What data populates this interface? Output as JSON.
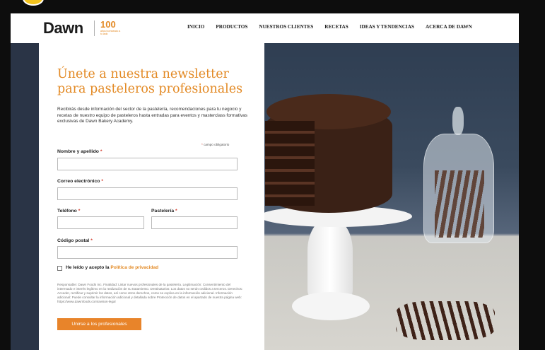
{
  "nav": {
    "logo_brand": "Dawn",
    "logo_anniversary": "100",
    "logo_anniversary_sub": "años horneando a tu lado",
    "items": [
      "INICIO",
      "PRODUCTOS",
      "NUESTROS CLIENTES",
      "RECETAS",
      "IDEAS Y TENDENCIAS",
      "ACERCA DE DAWN"
    ]
  },
  "form": {
    "title": "Únete a nuestra newsletter para pasteleros profesionales",
    "intro": "Recibirás desde información del sector de la pastelería, recomendaciones para tu negocio y recetas de nuestro equipo de pasteleros hasta entradas para eventos y masterclass formativas exclusivas de Dawn Bakery Academy.",
    "required_note": "campo obligatorio",
    "required_star": "*",
    "fields": {
      "name_label": "Nombre y apellido",
      "email_label": "Correo electrónico",
      "phone_label": "Teléfono",
      "bakery_label": "Pastelería",
      "postal_label": "Código postal"
    },
    "consent_prefix": "He leído y acepto la ",
    "consent_link": "Política de privacidad",
    "legal_text": "Responsable: Dawn Foods Inc. Finalidad: Listar nuevos profesionales de la pastelería. Legitimación: Consentimiento del interesado e interés legítimo en la realización de su tratamiento. Destinatarios: Los datos no serán cedidos a terceros. Derechos: Acceder, rectificar y suprimir los datos, así como otros derechos, como se explica en la información adicional. Información adicional: Puede consultar la información adicional y detallada sobre Protección de datos en el apartado de nuestra página web: https://www.dawnfoods.com/avisos-legal",
    "submit_label": "Unirse a los profesionales"
  },
  "colors": {
    "accent": "#e38a25",
    "required": "#d23a2b",
    "button": "#e8842a"
  }
}
